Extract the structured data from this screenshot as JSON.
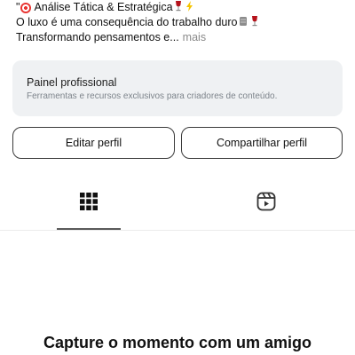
{
  "bio": {
    "line1_prefix": "\"",
    "line1_text": "Análise Tática & Estratégica",
    "line1_emojis": [
      "wine-glass-icon",
      "lightning-icon"
    ],
    "line2_text": "O luxo é uma consequência do trabalho duro",
    "line2_emojis": [
      "money-stack-icon",
      "wine-glass-icon"
    ],
    "line3_text": "Transformando pensamentos e...",
    "more_label": "mais"
  },
  "panel": {
    "title": "Painel profissional",
    "subtitle": "Ferramentas e recursos exclusivos para criadores de conteúdo."
  },
  "buttons": {
    "edit_label": "Editar perfil",
    "share_label": "Compartilhar perfil"
  },
  "tabs": [
    {
      "icon": "grid-icon",
      "active": true
    },
    {
      "icon": "reels-icon",
      "active": false
    }
  ],
  "empty_state": {
    "title": "Capture o momento com um amigo"
  },
  "colors": {
    "panel_bg": "#eff1f3",
    "muted_text": "#8a8a8a",
    "accent_red": "#e8322f"
  }
}
